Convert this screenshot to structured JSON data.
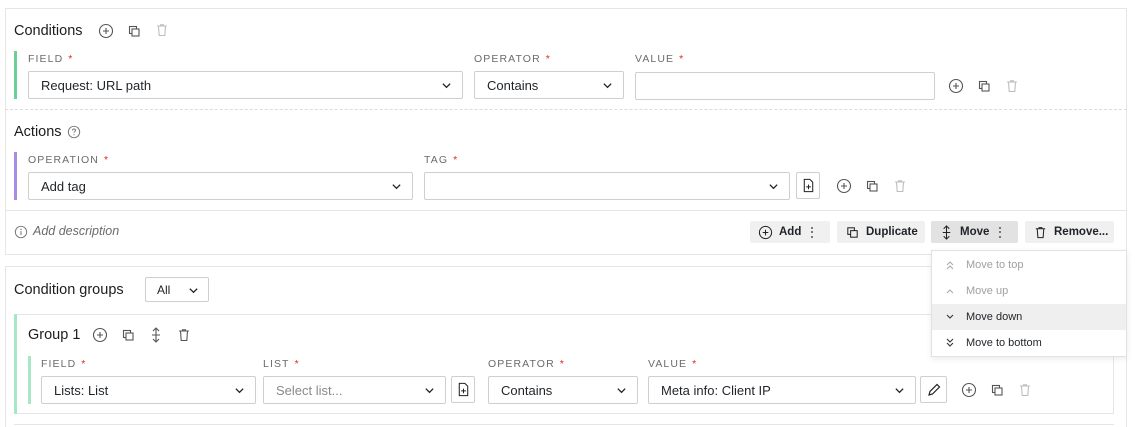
{
  "conditions": {
    "title": "Conditions",
    "field_label": "FIELD",
    "operator_label": "OPERATOR",
    "value_label": "VALUE",
    "required_mark": "*",
    "field_value": "Request: URL path",
    "operator_value": "Contains",
    "value_value": ""
  },
  "actions": {
    "title": "Actions",
    "operation_label": "OPERATION",
    "tag_label": "TAG",
    "operation_value": "Add tag",
    "tag_value": ""
  },
  "footer": {
    "description_placeholder": "Add description",
    "add_label": "Add",
    "duplicate_label": "Duplicate",
    "move_label": "Move",
    "remove_label": "Remove..."
  },
  "move_menu": {
    "items": [
      {
        "label": "Move to top",
        "disabled": true,
        "icon": "double-chevron-up-icon"
      },
      {
        "label": "Move up",
        "disabled": true,
        "icon": "chevron-up-icon"
      },
      {
        "label": "Move down",
        "disabled": false,
        "icon": "chevron-down-icon"
      },
      {
        "label": "Move to bottom",
        "disabled": false,
        "icon": "double-chevron-down-icon"
      }
    ]
  },
  "condition_groups": {
    "title": "Condition groups",
    "filter_value": "All",
    "group": {
      "title": "Group 1",
      "field_label": "FIELD",
      "list_label": "LIST",
      "operator_label": "OPERATOR",
      "value_label": "VALUE",
      "field_value": "Lists: List",
      "list_placeholder": "Select list...",
      "operator_value": "Contains",
      "value_value": "Meta info: Client IP"
    }
  },
  "colors": {
    "conditions_bar": "#6ccf95",
    "actions_bar": "#a98be8",
    "group_bar": "#a8e6c4",
    "required": "#d92d20"
  }
}
